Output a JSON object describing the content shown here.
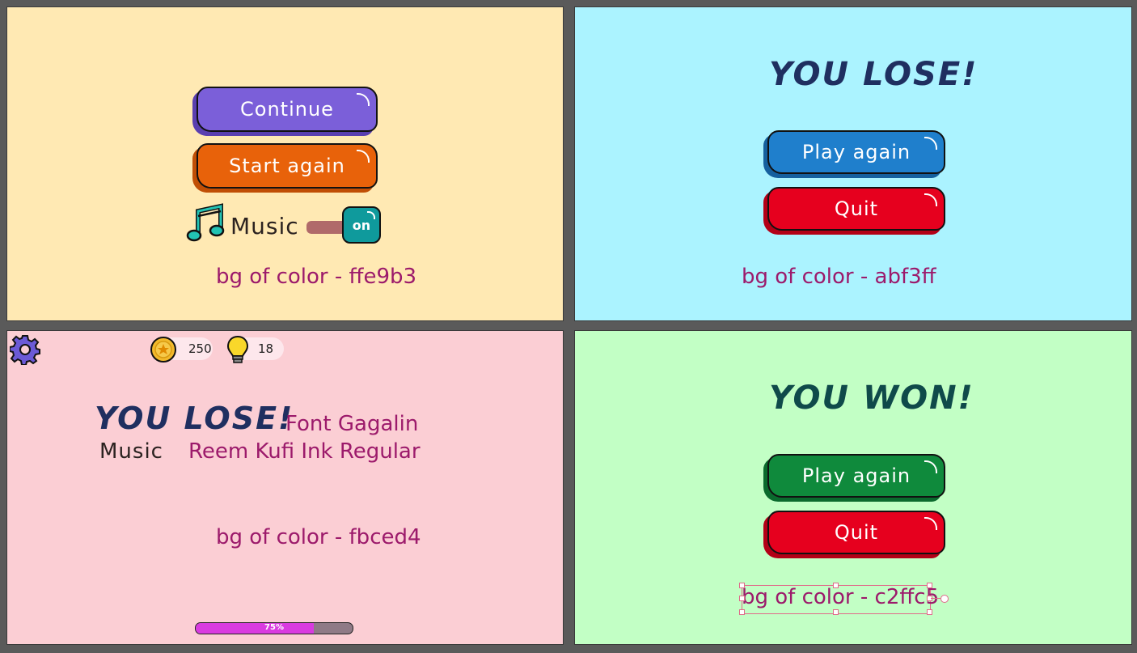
{
  "panel1": {
    "bg": "#ffe9b3",
    "continue_label": "Continue",
    "start_again_label": "Start again",
    "music_label": "Music",
    "toggle_label": "on",
    "caption": "bg of color - ffe9b3",
    "icons": {
      "music": "music-note-icon"
    }
  },
  "panel2": {
    "bg": "#abf3ff",
    "title": "YOU LOSE!",
    "play_again_label": "Play again",
    "quit_label": "Quit",
    "caption": "bg of color - abf3ff"
  },
  "panel3": {
    "bg": "#fbced4",
    "coins": "250",
    "hints": "18",
    "title": "YOU LOSE!",
    "font_title_note": "Font Gagalin",
    "music_label": "Music",
    "font_music_note": "Reem Kufi Ink Regular",
    "caption": "bg of color - fbced4",
    "progress_label": "75%",
    "progress_value": 0.75,
    "icons": {
      "settings": "gear-icon",
      "coin": "coin-icon",
      "hint": "lightbulb-icon"
    }
  },
  "panel4": {
    "bg": "#c2ffc5",
    "title": "YOU WON!",
    "play_again_label": "Play again",
    "quit_label": "Quit",
    "caption": "bg of color - c2ffc5"
  },
  "colors": {
    "purple_button": "#7b5fd9",
    "orange_button": "#e8620a",
    "blue_button": "#1f7fcc",
    "red_button": "#e6001e",
    "green_button": "#0f8a3c",
    "caption_text": "#9c1a6b",
    "title_text": "#1f2f60",
    "won_title_text": "#0f4a4a"
  }
}
